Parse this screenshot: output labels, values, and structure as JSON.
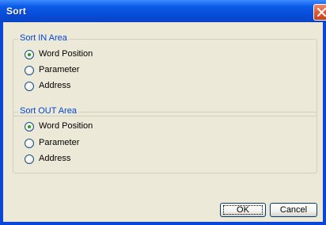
{
  "window": {
    "title": "Sort"
  },
  "groups": [
    {
      "legend": "Sort IN Area",
      "options": [
        {
          "label": "Word Position",
          "checked": true
        },
        {
          "label": "Parameter",
          "checked": false
        },
        {
          "label": "Address",
          "checked": false
        }
      ]
    },
    {
      "legend": "Sort OUT Area",
      "options": [
        {
          "label": "Word Position",
          "checked": true
        },
        {
          "label": "Parameter",
          "checked": false
        },
        {
          "label": "Address",
          "checked": false
        }
      ]
    }
  ],
  "buttons": {
    "ok": "OK",
    "cancel": "Cancel"
  },
  "colors": {
    "titlebar": "#0a5ae8",
    "legend": "#0046d5",
    "dialog_bg": "#ece9d8",
    "close": "#e05a32"
  }
}
